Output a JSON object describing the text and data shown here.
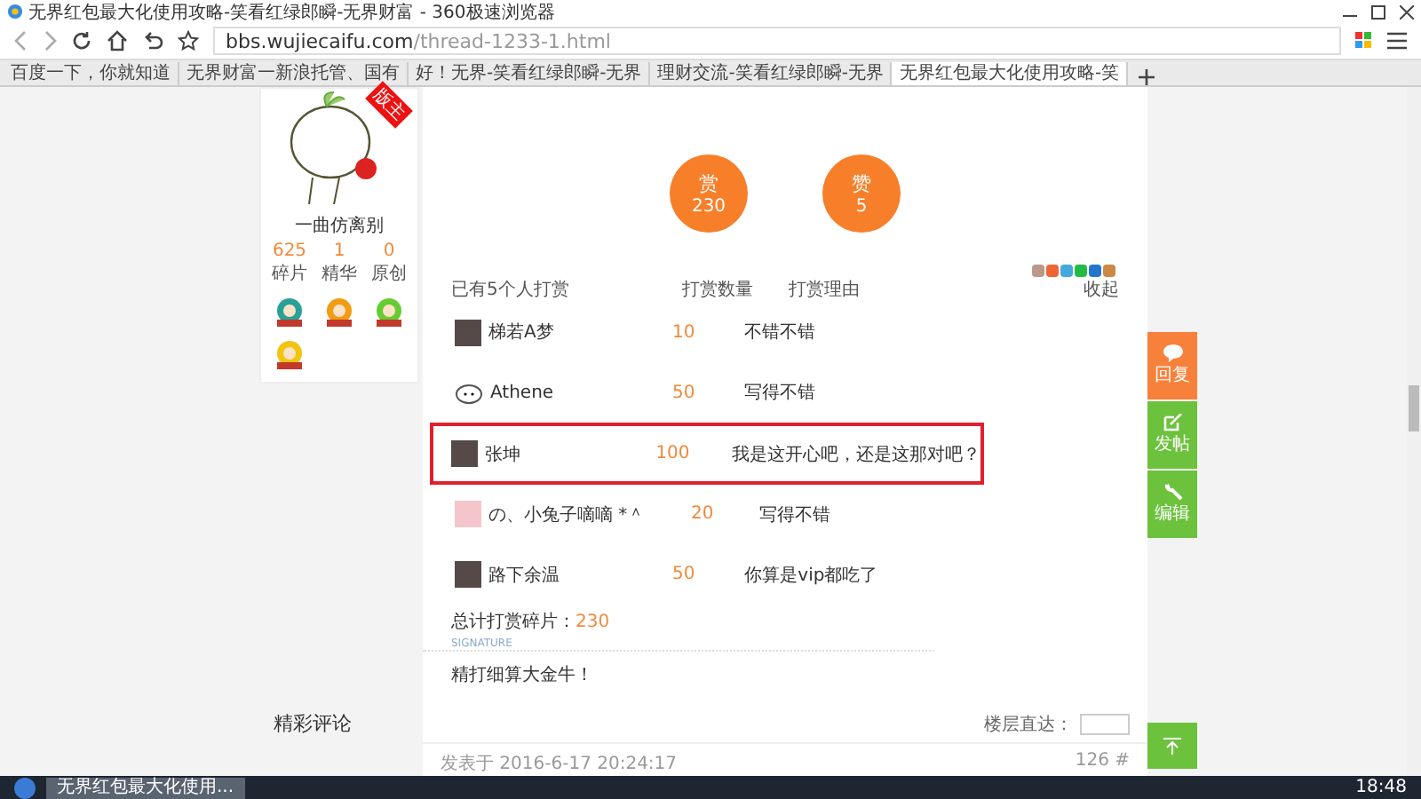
{
  "window": {
    "title": "无界红包最大化使用攻略-笑看红绿郎瞬-无界财富 - 360极速浏览器"
  },
  "address_bar": {
    "host": "bbs.wujiecaifu.com",
    "path": "/thread-1233-1.html"
  },
  "tabs": [
    {
      "label": "百度一下，你就知道",
      "selected": false
    },
    {
      "label": "无界财富一新浪托管、国有",
      "selected": false
    },
    {
      "label": "好！无界-笑看红绿郎瞬-无界",
      "selected": false
    },
    {
      "label": "理财交流-笑看红绿郎瞬-无界",
      "selected": false
    },
    {
      "label": "无界红包最大化使用攻略-笑",
      "selected": true
    }
  ],
  "profile": {
    "name": "一曲仿离别",
    "corner_tag": "版主",
    "stats": [
      {
        "value": "625",
        "label": "碎片"
      },
      {
        "value": "1",
        "label": "精华"
      },
      {
        "value": "0",
        "label": "原创"
      }
    ]
  },
  "reward_buttons": [
    {
      "label": "赏",
      "count": "230"
    },
    {
      "label": "赞",
      "count": "5"
    }
  ],
  "reward_table": {
    "columns": [
      "已有5个人打赏",
      "打赏数量",
      "打赏理由",
      "收起"
    ],
    "rows": [
      {
        "name": "梯若A梦",
        "amount": "10",
        "reason": "不错不错",
        "highlighted": false,
        "kind": "photo"
      },
      {
        "name": "Athene",
        "amount": "50",
        "reason": "写得不错",
        "highlighted": false,
        "kind": "face"
      },
      {
        "name": "张坤",
        "amount": "100",
        "reason": "我是这开心吧，还是这那对吧？",
        "highlighted": true,
        "kind": "photo"
      },
      {
        "name": "の、小兔子嘀嘀 *＾",
        "amount": "20",
        "reason": "写得不错",
        "highlighted": false,
        "kind": "pink"
      },
      {
        "name": "路下余温",
        "amount": "50",
        "reason": "你算是vip都吃了",
        "highlighted": false,
        "kind": "photo"
      }
    ],
    "total_label": "总计打赏碎片：",
    "total_value": "230"
  },
  "signature_label": "SIGNATURE",
  "signature_text": "精打细算大金牛！",
  "comments_heading": "精彩评论",
  "jump_label": "楼层直达：",
  "post_meta": {
    "posted": "发表于 2016-6-17 20:24:17",
    "floor": "126 #"
  },
  "side_buttons": [
    {
      "label": "回复",
      "kind": "reply"
    },
    {
      "label": "发帖",
      "kind": "post"
    },
    {
      "label": "编辑",
      "kind": "edit"
    }
  ],
  "taskbar": {
    "task": "无界红包最大化使用...",
    "time": "18:48"
  }
}
